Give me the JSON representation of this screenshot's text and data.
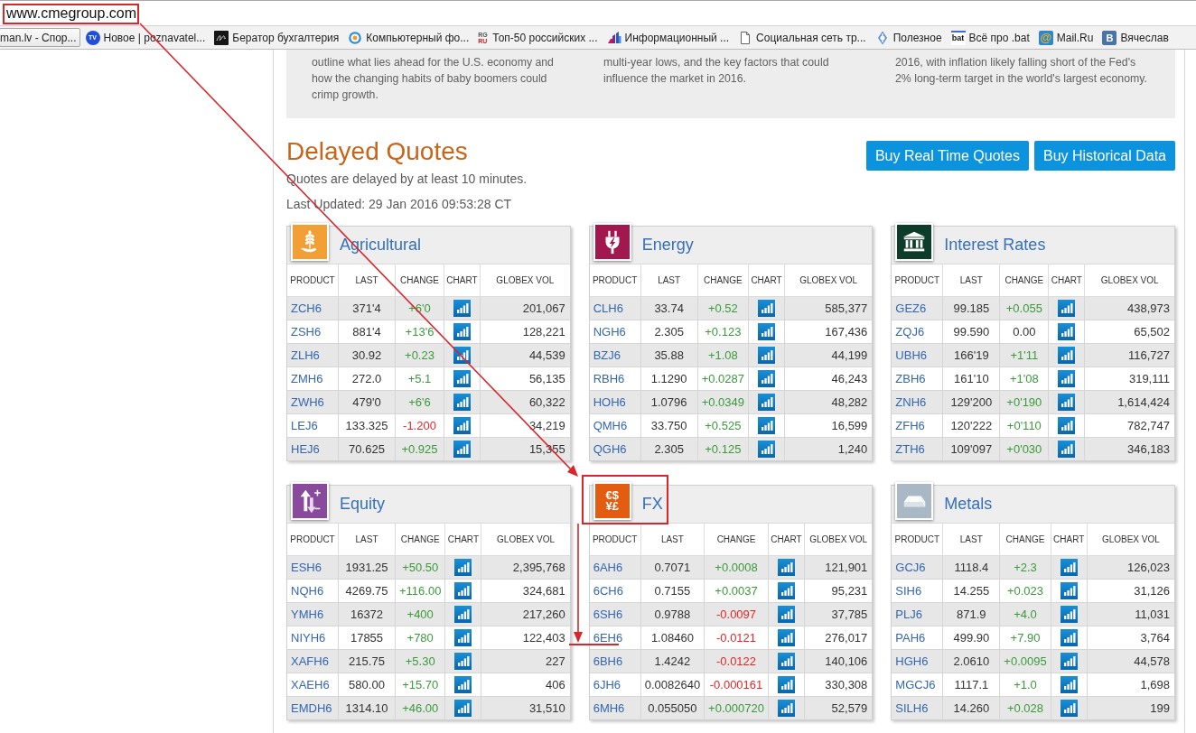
{
  "browser": {
    "address": "www.cmegroup.com",
    "bookmarks": [
      {
        "label": "man.lv - Спор...",
        "hovered": true
      },
      {
        "label": "Новое | poznavatel...",
        "kind": "disc",
        "icon_text": "TV",
        "hovered": false
      },
      {
        "label": "Бератор бухгалтерия",
        "kind": "signature",
        "hovered": false
      },
      {
        "label": "Компьютерный фо...",
        "kind": "ring",
        "hovered": false
      },
      {
        "label": "Топ-50 российских ...",
        "kind": "stack",
        "icon_text": "RG RU",
        "hovered": false
      },
      {
        "label": "Информационный ...",
        "kind": "bars",
        "hovered": false
      },
      {
        "label": "Социальная сеть тр...",
        "kind": "page",
        "hovered": false
      },
      {
        "label": "Полезное",
        "kind": "pin",
        "hovered": false
      },
      {
        "label": "Всё про .bat",
        "kind": "word",
        "icon_text": "bat",
        "hovered": false
      },
      {
        "label": "Mail.Ru",
        "kind": "at",
        "icon_text": "@",
        "hovered": false
      },
      {
        "label": "Вячеслав",
        "kind": "square",
        "icon_text": "B",
        "hovered": false
      }
    ]
  },
  "intro": {
    "paragraphs": [
      "outline what lies ahead for the U.S. economy and how the changing habits of baby boomers could crimp growth.",
      "multi-year lows, and the key factors that could influence the market in 2016.",
      "2016, with inflation likely falling short of the Fed's 2% long-term target in the world's largest economy."
    ]
  },
  "quotes": {
    "title": "Delayed Quotes",
    "note": "Quotes are delayed by at least 10 minutes.",
    "updated": "Last Updated: 29 Jan 2016 09:53:28 CT",
    "buttons": [
      "Buy Real Time Quotes",
      "Buy Historical Data"
    ]
  },
  "panels": [
    {
      "title": "Agricultural",
      "kind": "agricultural",
      "color": "#f2a035",
      "columns": [
        "PRODUCT",
        "LAST",
        "CHANGE",
        "CHART",
        "GLOBEX VOL"
      ],
      "rows": [
        {
          "product": "ZCH6",
          "last": "371'4",
          "change": "+6'0",
          "kind": "up",
          "volume": "201,067"
        },
        {
          "product": "ZSH6",
          "last": "881'4",
          "change": "+13'6",
          "kind": "up",
          "volume": "128,221"
        },
        {
          "product": "ZLH6",
          "last": "30.92",
          "change": "+0.23",
          "kind": "up",
          "volume": "44,539"
        },
        {
          "product": "ZMH6",
          "last": "272.0",
          "change": "+5.1",
          "kind": "up",
          "volume": "56,135"
        },
        {
          "product": "ZWH6",
          "last": "479'0",
          "change": "+6'6",
          "kind": "up",
          "volume": "60,322"
        },
        {
          "product": "LEJ6",
          "last": "133.325",
          "change": "-1.200",
          "kind": "down",
          "volume": "34,219"
        },
        {
          "product": "HEJ6",
          "last": "70.625",
          "change": "+0.925",
          "kind": "up",
          "volume": "15,355"
        }
      ]
    },
    {
      "title": "Energy",
      "kind": "energy",
      "color": "#a3174f",
      "columns": [
        "PRODUCT",
        "LAST",
        "CHANGE",
        "CHART",
        "GLOBEX VOL"
      ],
      "rows": [
        {
          "product": "CLH6",
          "last": "33.74",
          "change": "+0.52",
          "kind": "up",
          "volume": "585,377"
        },
        {
          "product": "NGH6",
          "last": "2.305",
          "change": "+0.123",
          "kind": "up",
          "volume": "167,436"
        },
        {
          "product": "BZJ6",
          "last": "35.88",
          "change": "+1.08",
          "kind": "up",
          "volume": "44,199"
        },
        {
          "product": "RBH6",
          "last": "1.1290",
          "change": "+0.0287",
          "kind": "up",
          "volume": "46,243"
        },
        {
          "product": "HOH6",
          "last": "1.0796",
          "change": "+0.0349",
          "kind": "up",
          "volume": "48,282"
        },
        {
          "product": "QMH6",
          "last": "33.750",
          "change": "+0.525",
          "kind": "up",
          "volume": "16,599"
        },
        {
          "product": "QGH6",
          "last": "2.305",
          "change": "+0.125",
          "kind": "up",
          "volume": "1,240"
        }
      ]
    },
    {
      "title": "Interest Rates",
      "kind": "rates",
      "color": "#0e3c2b",
      "columns": [
        "PRODUCT",
        "LAST",
        "CHANGE",
        "CHART",
        "GLOBEX VOL"
      ],
      "rows": [
        {
          "product": "GEZ6",
          "last": "99.185",
          "change": "+0.055",
          "kind": "up",
          "volume": "438,973"
        },
        {
          "product": "ZQJ6",
          "last": "99.590",
          "change": "0.00",
          "kind": "flat",
          "volume": "65,502"
        },
        {
          "product": "UBH6",
          "last": "166'19",
          "change": "+1'11",
          "kind": "up",
          "volume": "116,727"
        },
        {
          "product": "ZBH6",
          "last": "161'10",
          "change": "+1'08",
          "kind": "up",
          "volume": "319,111"
        },
        {
          "product": "ZNH6",
          "last": "129'200",
          "change": "+0'190",
          "kind": "up",
          "volume": "1,614,424"
        },
        {
          "product": "ZFH6",
          "last": "120'222",
          "change": "+0'110",
          "kind": "up",
          "volume": "782,747"
        },
        {
          "product": "ZTH6",
          "last": "109'097",
          "change": "+0'030",
          "kind": "up",
          "volume": "346,183"
        }
      ]
    },
    {
      "title": "Equity",
      "kind": "equity",
      "color": "#8a4a9c",
      "columns": [
        "PRODUCT",
        "LAST",
        "CHANGE",
        "CHART",
        "GLOBEX VOL"
      ],
      "rows": [
        {
          "product": "ESH6",
          "last": "1931.25",
          "change": "+50.50",
          "kind": "up",
          "volume": "2,395,768"
        },
        {
          "product": "NQH6",
          "last": "4269.75",
          "change": "+116.00",
          "kind": "up",
          "volume": "324,681"
        },
        {
          "product": "YMH6",
          "last": "16372",
          "change": "+400",
          "kind": "up",
          "volume": "217,260"
        },
        {
          "product": "NIYH6",
          "last": "17855",
          "change": "+780",
          "kind": "up",
          "volume": "122,403"
        },
        {
          "product": "XAFH6",
          "last": "215.75",
          "change": "+5.30",
          "kind": "up",
          "volume": "227"
        },
        {
          "product": "XAEH6",
          "last": "580.00",
          "change": "+15.70",
          "kind": "up",
          "volume": "406"
        },
        {
          "product": "EMDH6",
          "last": "1314.10",
          "change": "+46.00",
          "kind": "up",
          "volume": "31,510"
        }
      ]
    },
    {
      "title": "FX",
      "kind": "fx",
      "color": "#e25d10",
      "icon_text": "€$¥£",
      "columns": [
        "PRODUCT",
        "LAST",
        "CHANGE",
        "CHART",
        "GLOBEX VOL"
      ],
      "rows": [
        {
          "product": "6AH6",
          "last": "0.7071",
          "change": "+0.0008",
          "kind": "up",
          "volume": "121,901"
        },
        {
          "product": "6CH6",
          "last": "0.7155",
          "change": "+0.0037",
          "kind": "up",
          "volume": "95,231"
        },
        {
          "product": "6SH6",
          "last": "0.9788",
          "change": "-0.0097",
          "kind": "down",
          "volume": "37,785"
        },
        {
          "product": "6EH6",
          "last": "1.08460",
          "change": "-0.0121",
          "kind": "down",
          "volume": "276,017"
        },
        {
          "product": "6BH6",
          "last": "1.4242",
          "change": "-0.0122",
          "kind": "down",
          "volume": "140,106"
        },
        {
          "product": "6JH6",
          "last": "0.0082640",
          "change": "-0.000161",
          "kind": "down",
          "volume": "330,308"
        },
        {
          "product": "6MH6",
          "last": "0.055050",
          "change": "+0.000720",
          "kind": "up",
          "volume": "52,579"
        }
      ]
    },
    {
      "title": "Metals",
      "kind": "metals",
      "color": "#a9b8c4",
      "columns": [
        "PRODUCT",
        "LAST",
        "CHANGE",
        "CHART",
        "GLOBEX VOL"
      ],
      "rows": [
        {
          "product": "GCJ6",
          "last": "1118.4",
          "change": "+2.3",
          "kind": "up",
          "volume": "126,023"
        },
        {
          "product": "SIH6",
          "last": "14.255",
          "change": "+0.023",
          "kind": "up",
          "volume": "31,126"
        },
        {
          "product": "PLJ6",
          "last": "871.9",
          "change": "+4.0",
          "kind": "up",
          "volume": "11,031"
        },
        {
          "product": "PAH6",
          "last": "499.90",
          "change": "+7.90",
          "kind": "up",
          "volume": "3,764"
        },
        {
          "product": "HGH6",
          "last": "2.0610",
          "change": "+0.0095",
          "kind": "up",
          "volume": "44,578"
        },
        {
          "product": "MGCJ6",
          "last": "1117.1",
          "change": "+1.0",
          "kind": "up",
          "volume": "1,698"
        },
        {
          "product": "SILH6",
          "last": "14.260",
          "change": "+0.028",
          "kind": "up",
          "volume": "199"
        }
      ]
    }
  ]
}
